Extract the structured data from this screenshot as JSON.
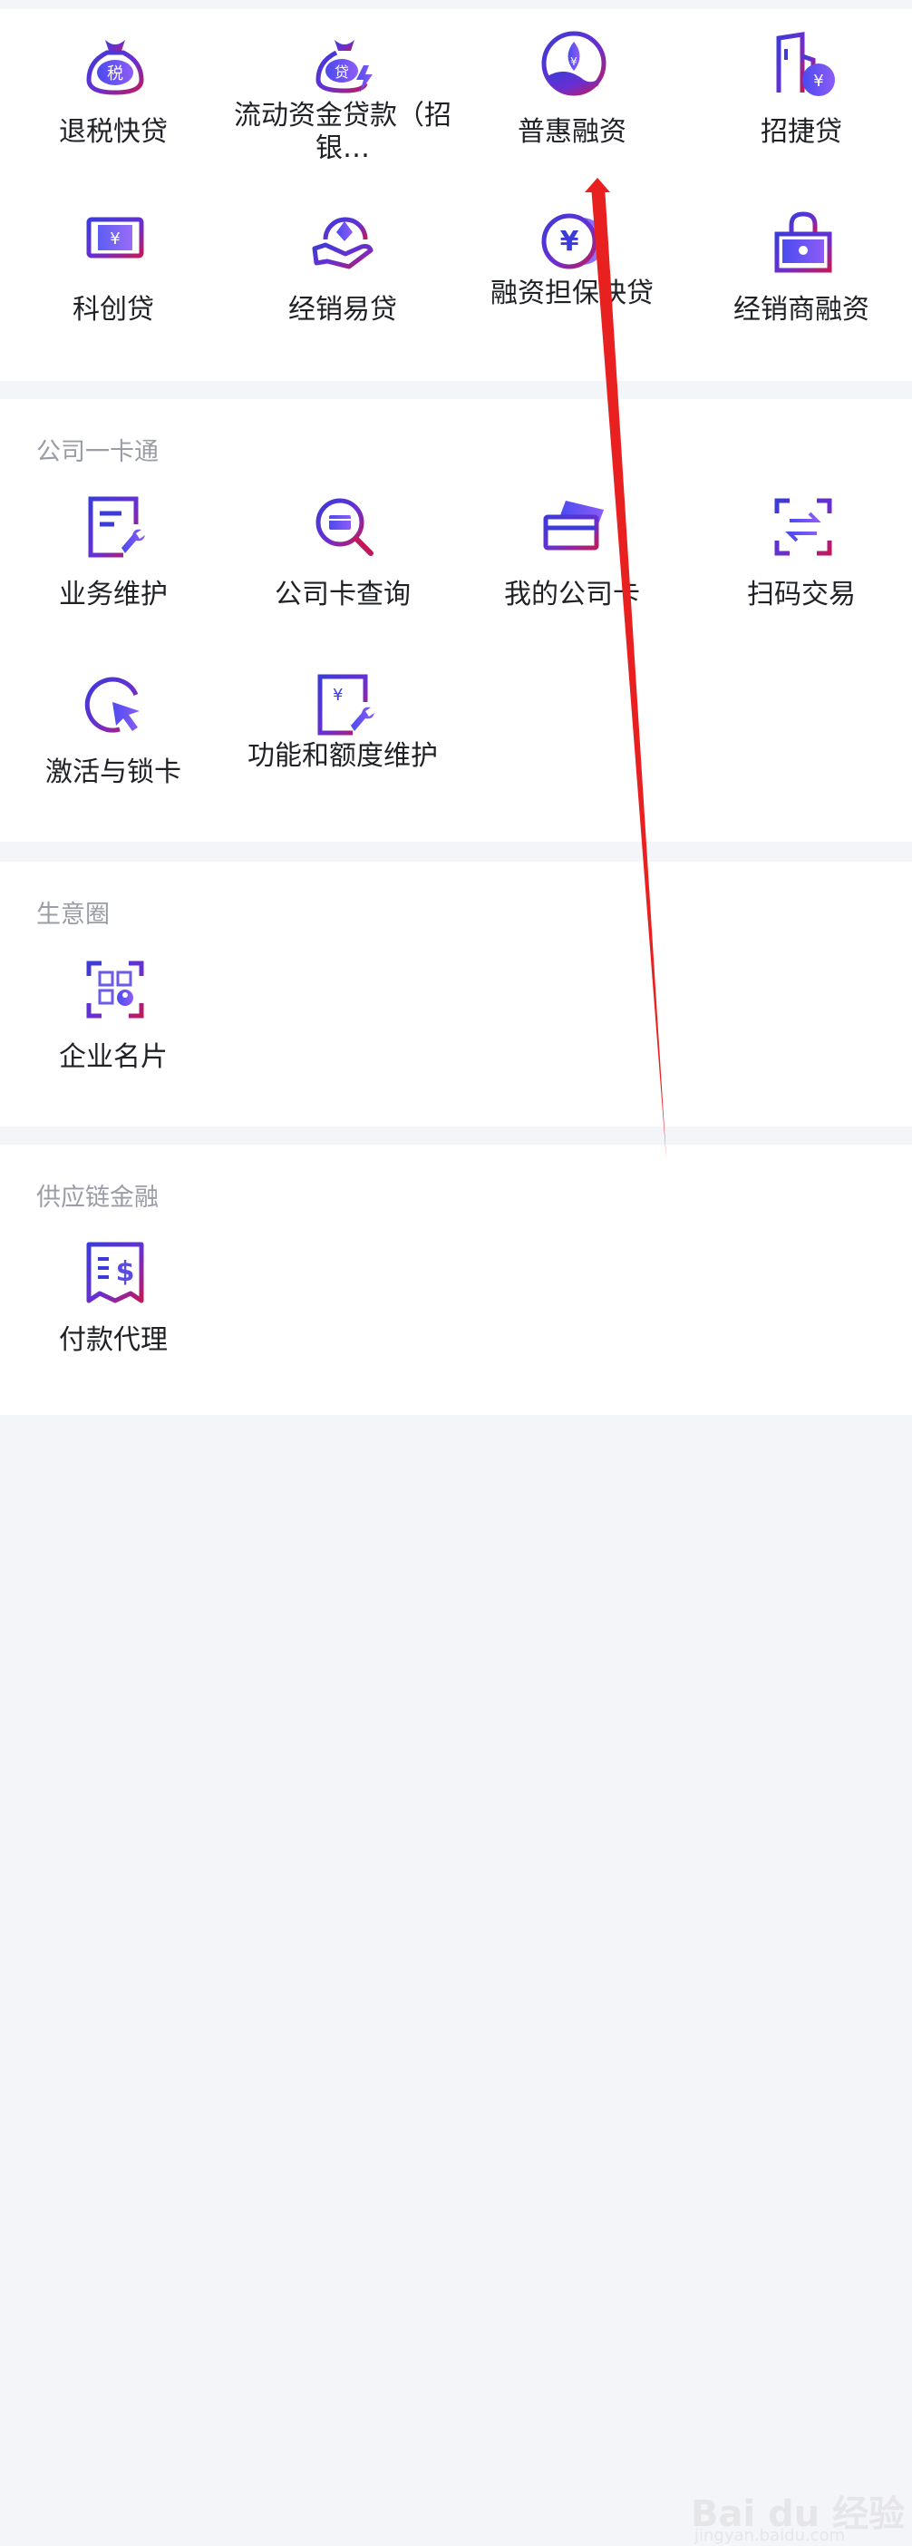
{
  "loans": {
    "items": [
      {
        "label": "退税快贷",
        "icon": "tax-bag-icon"
      },
      {
        "label": "流动资金贷款（招银…",
        "icon": "loan-bag-icon"
      },
      {
        "label": "普惠融资",
        "icon": "plant-coin-icon"
      },
      {
        "label": "招捷贷",
        "icon": "building-coin-icon"
      },
      {
        "label": "科创贷",
        "icon": "monitor-yuan-icon"
      },
      {
        "label": "经销易贷",
        "icon": "hand-diamond-icon"
      },
      {
        "label": "融资担保快贷",
        "icon": "yuan-coin-icon"
      },
      {
        "label": "经销商融资",
        "icon": "lock-bag-icon"
      }
    ]
  },
  "card": {
    "title": "公司一卡通",
    "items": [
      {
        "label": "业务维护",
        "icon": "document-wrench-icon"
      },
      {
        "label": "公司卡查询",
        "icon": "card-search-icon"
      },
      {
        "label": "我的公司卡",
        "icon": "cards-icon"
      },
      {
        "label": "扫码交易",
        "icon": "scan-exchange-icon"
      },
      {
        "label": "激活与锁卡",
        "icon": "cursor-circle-icon"
      },
      {
        "label": "功能和额度维护",
        "icon": "yuan-doc-wrench-icon"
      }
    ]
  },
  "biz": {
    "title": "生意圈",
    "items": [
      {
        "label": "企业名片",
        "icon": "qr-card-icon"
      }
    ]
  },
  "supply": {
    "title": "供应链金融",
    "items": [
      {
        "label": "付款代理",
        "icon": "receipt-dollar-icon"
      }
    ]
  },
  "watermark": {
    "brand": "Bai du 经验",
    "url": "jingyan.baidu.com"
  },
  "colors": {
    "icon_blue": "#3b3bd9",
    "icon_purple": "#7a2fd0",
    "icon_magenta": "#c2185b",
    "annotation_red": "#e8201f"
  }
}
